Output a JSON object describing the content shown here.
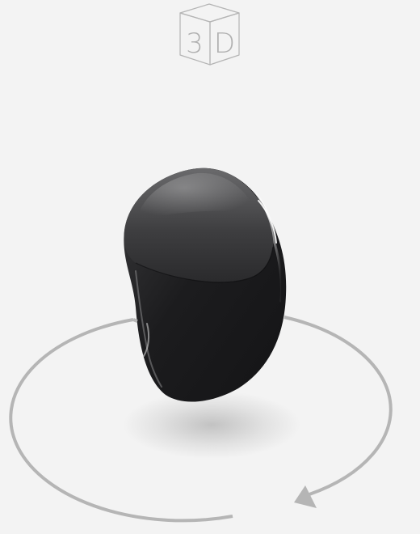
{
  "badge": {
    "icon": "3d-cube-icon",
    "text_left": "3",
    "text_right": "D"
  },
  "model": {
    "icon": "earbud-3d-model",
    "body_color": "#1e1e20",
    "highlight_color": "#8a8a8c"
  },
  "rotation_control": {
    "icon": "rotate-arrow-icon",
    "ring_color": "#b5b5b5"
  }
}
